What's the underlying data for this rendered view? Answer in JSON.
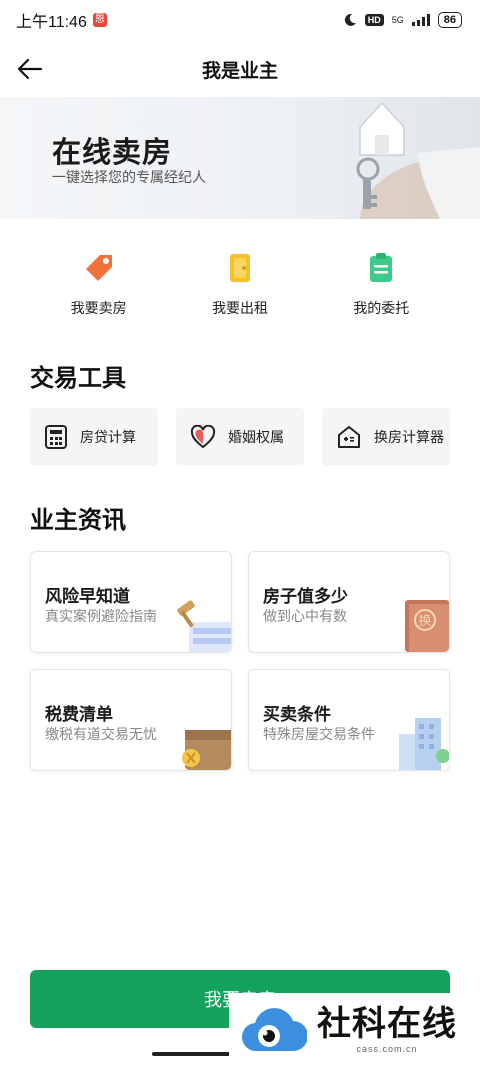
{
  "status_bar": {
    "time": "上午11:46",
    "notification_glyph": "恩",
    "hd": "HD",
    "network": "5G",
    "battery": "86"
  },
  "header": {
    "title": "我是业主"
  },
  "banner": {
    "title": "在线卖房",
    "subtitle": "一键选择您的专属经纪人"
  },
  "quick_actions": [
    {
      "label": "我要卖房",
      "icon": "price-tag-icon",
      "color": "#f2703a"
    },
    {
      "label": "我要出租",
      "icon": "door-icon",
      "color": "#f5c22b"
    },
    {
      "label": "我的委托",
      "icon": "clipboard-icon",
      "color": "#3ecb8a"
    }
  ],
  "tools": {
    "title": "交易工具",
    "items": [
      {
        "label": "房贷计算",
        "icon": "calculator-icon"
      },
      {
        "label": "婚姻权属",
        "icon": "heart-icon"
      },
      {
        "label": "换房计算器",
        "icon": "house-calc-icon"
      }
    ]
  },
  "news": {
    "title": "业主资讯",
    "cards": [
      {
        "title": "风险早知道",
        "subtitle": "真实案例避险指南",
        "icon": "gavel-icon"
      },
      {
        "title": "房子值多少",
        "subtitle": "做到心中有数",
        "icon": "property-cert-icon",
        "art_text": "换"
      },
      {
        "title": "税费清单",
        "subtitle": "缴税有道交易无忧",
        "icon": "wallet-icon"
      },
      {
        "title": "买卖条件",
        "subtitle": "特殊房屋交易条件",
        "icon": "building-icon"
      }
    ]
  },
  "cta": {
    "label": "我要卖房"
  },
  "watermark": {
    "name": "社科在线",
    "url": "cass.com.cn"
  },
  "colors": {
    "primary_green": "#14a35c",
    "orange": "#f2703a",
    "yellow": "#f5c22b",
    "mint": "#3ecb8a"
  }
}
